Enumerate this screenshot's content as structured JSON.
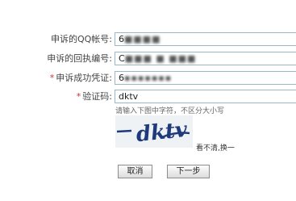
{
  "form": {
    "qq_label": "申诉的QQ帐号:",
    "qq_value": "6",
    "receipt_label": "申诉的回执编号:",
    "receipt_value": "C",
    "success_label": "申诉成功凭证:",
    "success_value": "6",
    "captcha_label": "验证码:",
    "captcha_value": "dktv",
    "required_mark": "*"
  },
  "captcha": {
    "hint": "请输入下图中字符，不区分大小写",
    "image_text": "dktv",
    "refresh_link": "看不清,换一"
  },
  "buttons": {
    "cancel": "取消",
    "next": "下一步"
  },
  "colors": {
    "field_border": "#9ab7c9",
    "required_star": "#cc3333",
    "captcha_ink": "#1f3a7a"
  }
}
